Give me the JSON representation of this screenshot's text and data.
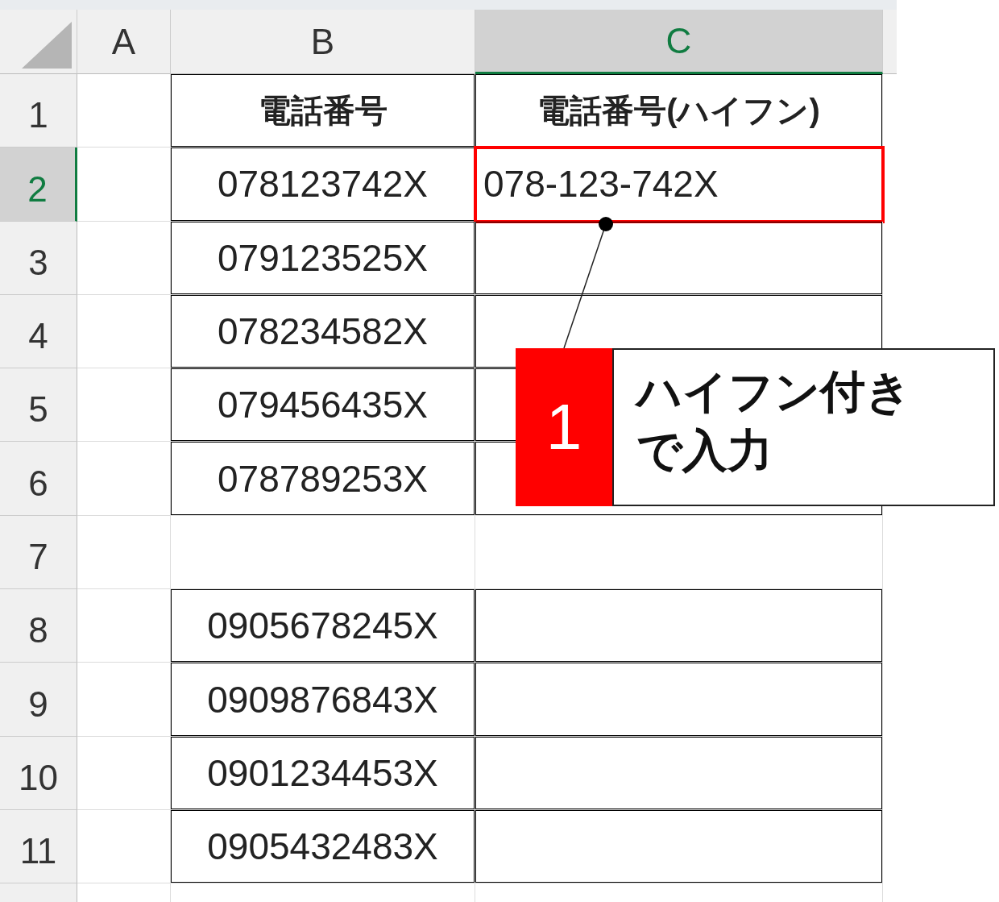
{
  "columns": [
    {
      "label": "A",
      "selected": false
    },
    {
      "label": "B",
      "selected": false
    },
    {
      "label": "C",
      "selected": true
    }
  ],
  "rows": [
    {
      "number": "1",
      "selected": false,
      "bordered": true,
      "kind": "header",
      "b": "電話番号",
      "c": "電話番号(ハイフン)",
      "highlighted": false
    },
    {
      "number": "2",
      "selected": true,
      "bordered": true,
      "kind": "data",
      "b": "078123742X",
      "c": "078-123-742X",
      "highlighted": true
    },
    {
      "number": "3",
      "selected": false,
      "bordered": true,
      "kind": "data",
      "b": "079123525X",
      "highlighted": false
    },
    {
      "number": "4",
      "selected": false,
      "bordered": true,
      "kind": "data",
      "b": "078234582X",
      "highlighted": false
    },
    {
      "number": "5",
      "selected": false,
      "bordered": true,
      "kind": "data",
      "b": "079456435X",
      "highlighted": false
    },
    {
      "number": "6",
      "selected": false,
      "bordered": true,
      "kind": "data",
      "b": "078789253X",
      "highlighted": false
    },
    {
      "number": "7",
      "selected": false,
      "bordered": false,
      "kind": "data",
      "highlighted": false
    },
    {
      "number": "8",
      "selected": false,
      "bordered": true,
      "kind": "data",
      "b": "0905678245X",
      "highlighted": false
    },
    {
      "number": "9",
      "selected": false,
      "bordered": true,
      "kind": "data",
      "b": "0909876843X",
      "highlighted": false
    },
    {
      "number": "10",
      "selected": false,
      "bordered": true,
      "kind": "data",
      "b": "0901234453X",
      "highlighted": false
    },
    {
      "number": "11",
      "selected": false,
      "bordered": true,
      "kind": "data",
      "b": "0905432483X",
      "highlighted": false
    }
  ],
  "callout": {
    "step": "1",
    "text": "ハイフン付きで入力"
  }
}
